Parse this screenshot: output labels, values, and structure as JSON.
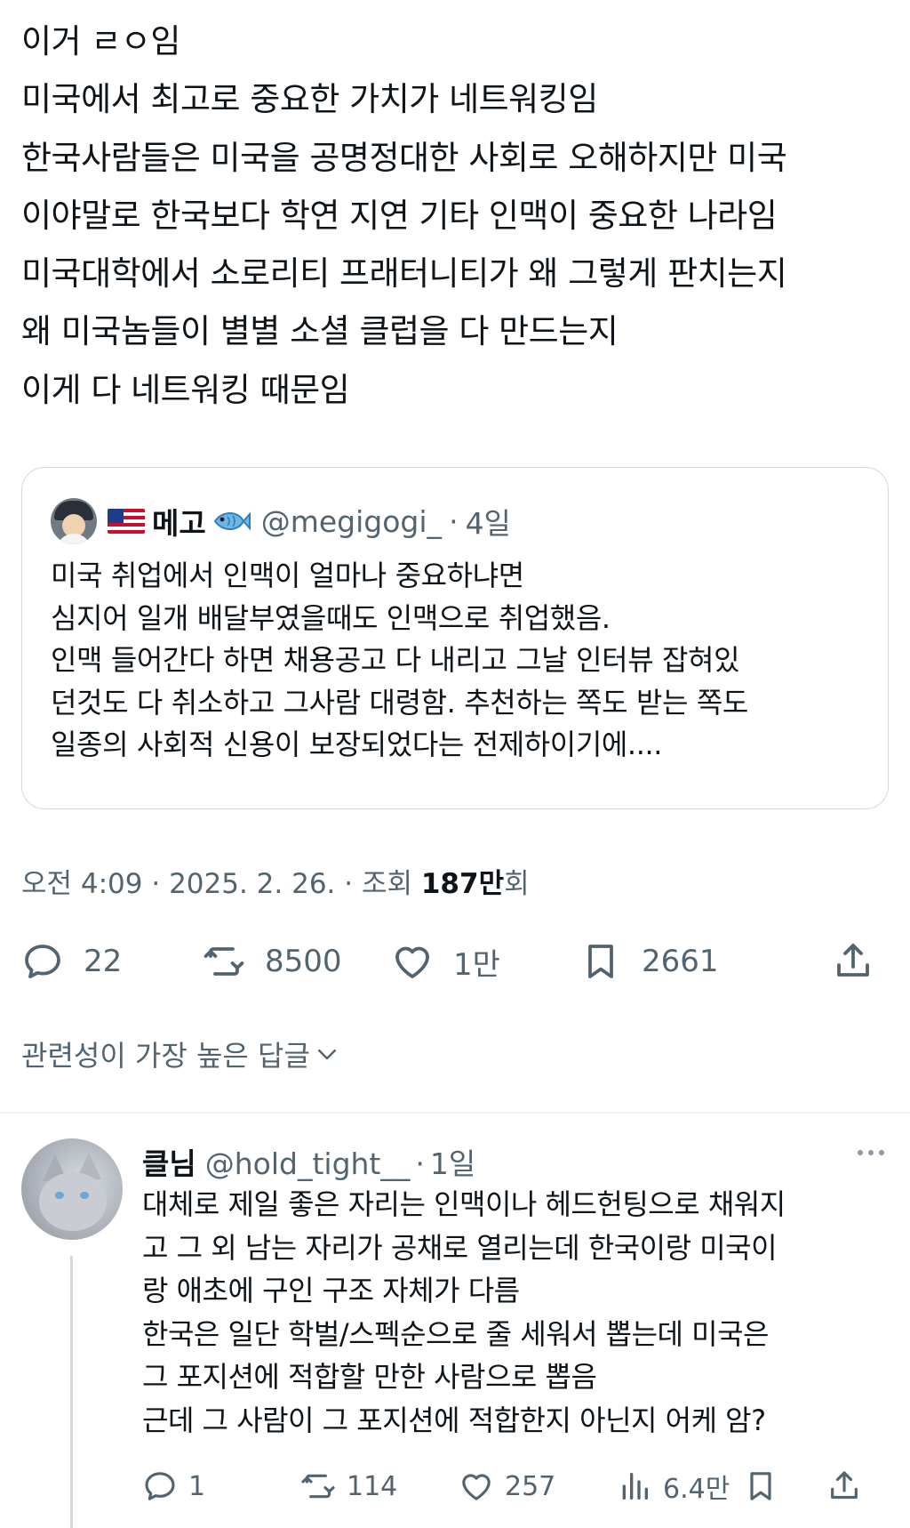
{
  "tweet": {
    "lines": [
      "이거 ㄹㅇ임",
      "미국에서 최고로 중요한 가치가 네트워킹임",
      "한국사람들은 미국을 공명정대한 사회로 오해하지만 미국",
      "이야말로 한국보다 학연 지연 기타 인맥이 중요한 나라임",
      "미국대학에서 소로리티 프래터니티가 왜 그렇게 판치는지",
      "왜 미국놈들이 별별 소셜 클럽을 다 만드는지",
      "이게 다 네트워킹 때문임"
    ]
  },
  "quote": {
    "name": "메고",
    "handle": "@megigogi_",
    "dot": "·",
    "time": "4일",
    "lines": [
      "미국 취업에서 인맥이 얼마나 중요하냐면",
      "심지어 일개 배달부였을때도 인맥으로 취업했음.",
      "인맥 들어간다 하면 채용공고 다 내리고 그날 인터뷰 잡혀있",
      "던것도 다 취소하고 그사람 대령함. 추천하는 쪽도 받는 쪽도",
      "일종의 사회적 신용이 보장되었다는 전제하이기에...."
    ]
  },
  "meta": {
    "prefix": "오전 4:09 · 2025. 2. 26. · 조회 ",
    "views_num": "187만",
    "views_suffix": "회"
  },
  "actions": {
    "replies": "22",
    "reposts": "8500",
    "likes": "1만",
    "bookmarks": "2661"
  },
  "sort_label": "관련성이 가장 높은 답글",
  "reply": {
    "name": "클님",
    "handle": "@hold_tight__",
    "dot": "·",
    "time": "1일",
    "lines": [
      "대체로 제일 좋은 자리는 인맥이나 헤드헌팅으로 채워지",
      "고 그 외 남는 자리가 공채로 열리는데 한국이랑 미국이",
      "랑 애초에 구인 구조 자체가 다름",
      "한국은 일단 학벌/스펙순으로 줄 세워서 뽑는데 미국은",
      "그 포지션에 적합할 만한 사람으로 뽑음",
      "근데 그 사람이 그 포지션에 적합한지 아닌지 어케 암?"
    ],
    "actions": {
      "replies": "1",
      "reposts": "114",
      "likes": "257",
      "views": "6.4만"
    }
  },
  "colors": {
    "text": "#0f1419",
    "secondary": "#536471",
    "border": "#cfd9de"
  }
}
